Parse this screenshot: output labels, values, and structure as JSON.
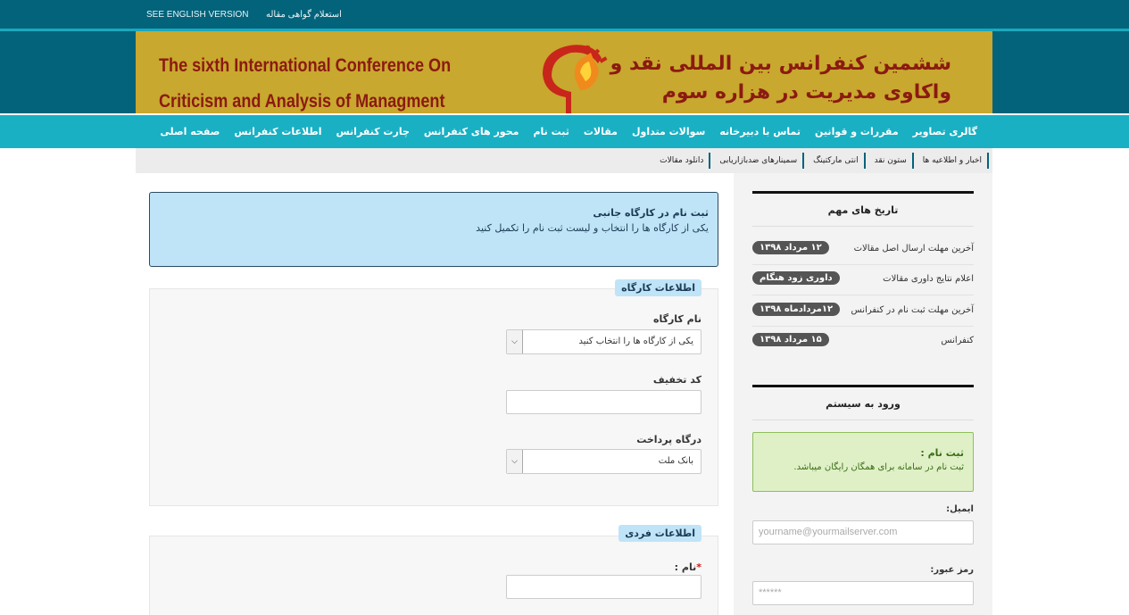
{
  "topbar": {
    "english_link": "SEE ENGLISH VERSION",
    "certificate_link": "استعلام گواهی مقاله"
  },
  "banner": {
    "title_en_line1": "The sixth International Conference On",
    "title_en_line2": "Criticism and Analysis of Managment",
    "title_fa_line1": "ششمین کنفرانس بین المللی نقد و",
    "title_fa_line2": "واکاوی مدیریت در هزاره سوم",
    "logo_icon": "head-logo-icon"
  },
  "nav": {
    "items": [
      {
        "label": "صفحه اصلی"
      },
      {
        "label": "اطلاعات کنفرانس"
      },
      {
        "label": "چارت کنفرانس"
      },
      {
        "label": "محور های کنفرانس"
      },
      {
        "label": "ثبت نام"
      },
      {
        "label": "مقالات"
      },
      {
        "label": "سوالات متداول"
      },
      {
        "label": "تماس با دبیرخانه"
      },
      {
        "label": "مقررات و قوانین"
      },
      {
        "label": "گالری تصاویر"
      }
    ]
  },
  "subnav": {
    "items": [
      {
        "label": "اخبار و اطلاعیه ها"
      },
      {
        "label": "ستون نقد"
      },
      {
        "label": "انتی مارکتینگ"
      },
      {
        "label": "سمینارهای ضدبازاریابی"
      },
      {
        "label": "دانلود مقالات"
      }
    ]
  },
  "alert": {
    "title": "ثبت نام در کارگاه جانبی",
    "description": "یکی از کارگاه ها را انتخاب و لیست ثبت نام را تکمیل کنید"
  },
  "workshop_section": {
    "legend": "اطلاعات کارگاه",
    "workshop_label": "نام کارگاه",
    "workshop_value": "یکی از کارگاه ها را انتخاب کنید",
    "discount_label": "کد تخفیف",
    "gateway_label": "درگاه پرداخت",
    "gateway_value": "بانک ملت"
  },
  "personal_section": {
    "legend": "اطلاعات فردی",
    "name_label": "نام :",
    "required_mark": "*"
  },
  "dates": {
    "title": "تاریخ های مهم",
    "rows": [
      {
        "label": "آخرین مهلت ارسال اصل مقالات",
        "date": "۱۲ مرداد ۱۳۹۸"
      },
      {
        "label": "اعلام نتایج داوری مقالات",
        "date": "داوری زود هنگام"
      },
      {
        "label": "آخرین مهلت ثبت نام در کنفرانس",
        "date": "۱۲مردادماه ۱۳۹۸"
      },
      {
        "label": "کنفرانس",
        "date": "۱۵ مرداد ۱۳۹۸"
      }
    ]
  },
  "login": {
    "title": "ورود به سیستم",
    "register_title": "ثبت نام :",
    "register_text": "ثبت نام در سامانه برای همگان رایگان میباشد.",
    "email_label": "ایمیل:",
    "email_placeholder": "yourname@yourmailserver.com",
    "password_label": "رمز عبور:",
    "password_placeholder": "******"
  }
}
